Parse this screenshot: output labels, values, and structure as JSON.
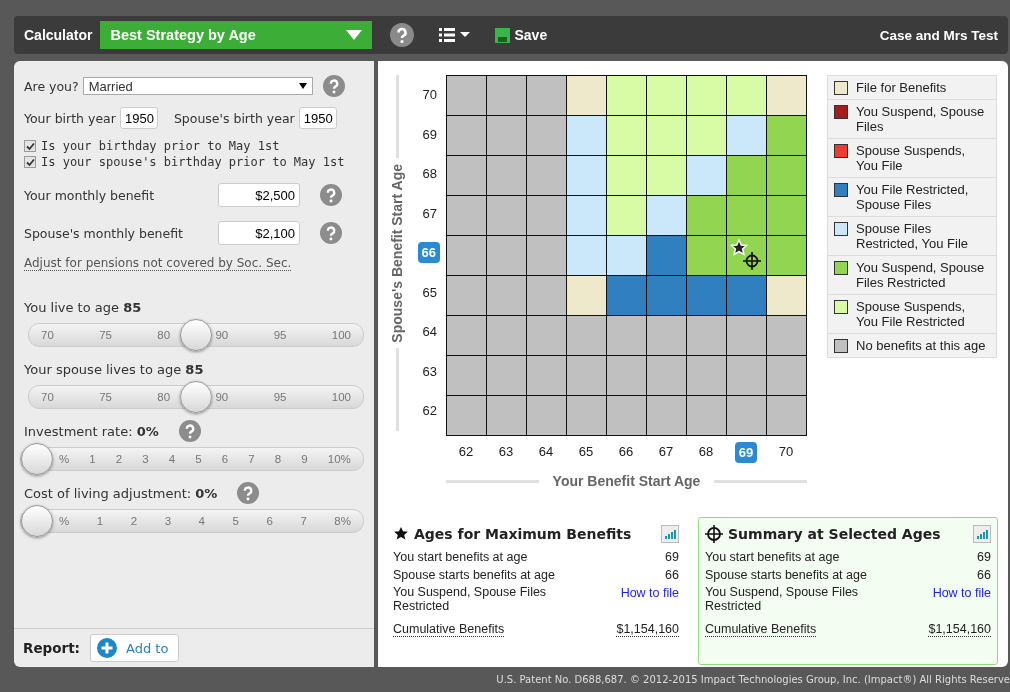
{
  "top_bar": {
    "title": "Calculator",
    "view_select": "Best Strategy by Age",
    "save": "Save",
    "user": "Case and Mrs Test"
  },
  "form": {
    "marital": {
      "label": "Are you?",
      "value": "Married",
      "help": true
    },
    "birth_years": [
      {
        "label": "Your birth year",
        "value": "1950"
      },
      {
        "label": "Spouse's birth year",
        "value": "1950"
      }
    ],
    "checkboxes": [
      {
        "label": "Is your birthday prior to May 1st",
        "checked": true
      },
      {
        "label": "Is your spouse's birthday prior to May 1st",
        "checked": true
      }
    ],
    "benefits": [
      {
        "label": "Your monthly benefit",
        "value": "$2,500",
        "help": true
      },
      {
        "label": "Spouse's monthly benefit",
        "value": "$2,100",
        "help": true
      }
    ],
    "pension_link": "Adjust for pensions not covered by Soc. Sec.",
    "sliders": [
      {
        "label": "You live to age **85**",
        "help": false,
        "level": 0.5,
        "ticks": [
          "70",
          "75",
          "80",
          "90",
          "95",
          "100"
        ]
      },
      {
        "label": "Your spouse lives to age **85**",
        "help": false,
        "level": 0.5,
        "ticks": [
          "70",
          "75",
          "80",
          "90",
          "95",
          "100"
        ]
      },
      {
        "label": "Investment rate: **0%**",
        "help": true,
        "level": 0,
        "ticks": [
          "%",
          "1",
          "2",
          "3",
          "4",
          "5",
          "6",
          "7",
          "8",
          "9",
          "10%"
        ]
      },
      {
        "label": "Cost of living adjustment: **0%**",
        "help": true,
        "level": 0,
        "ticks": [
          "%",
          "1",
          "2",
          "3",
          "4",
          "5",
          "6",
          "7",
          "8%"
        ]
      }
    ]
  },
  "report": {
    "label": "Report:",
    "button": "Add to"
  },
  "grid": {
    "y_title": "Spouse's Benefit Start Age",
    "x_title": "Your Benefit Start Age",
    "rows": [
      {
        "label": "70",
        "selected": false,
        "max": false,
        "cells": [
          {
            "color": "#c0c0c0"
          },
          {
            "color": "#c0c0c0"
          },
          {
            "color": "#c0c0c0"
          },
          {
            "color": "#efe9cb"
          },
          {
            "color": "#d8fba6"
          },
          {
            "color": "#d8fba6"
          },
          {
            "color": "#d8fba6"
          },
          {
            "color": "#d8fba6"
          },
          {
            "color": "#efe9cb"
          }
        ]
      },
      {
        "label": "69",
        "selected": false,
        "max": false,
        "cells": [
          {
            "color": "#c0c0c0"
          },
          {
            "color": "#c0c0c0"
          },
          {
            "color": "#c0c0c0"
          },
          {
            "color": "#cbe8fb"
          },
          {
            "color": "#d8fba6"
          },
          {
            "color": "#d8fba6"
          },
          {
            "color": "#d8fba6"
          },
          {
            "color": "#cbe8fb"
          },
          {
            "color": "#92d550"
          }
        ]
      },
      {
        "label": "68",
        "selected": false,
        "max": false,
        "cells": [
          {
            "color": "#c0c0c0"
          },
          {
            "color": "#c0c0c0"
          },
          {
            "color": "#c0c0c0"
          },
          {
            "color": "#cbe8fb"
          },
          {
            "color": "#d8fba6"
          },
          {
            "color": "#d8fba6"
          },
          {
            "color": "#cbe8fb"
          },
          {
            "color": "#92d550"
          },
          {
            "color": "#92d550"
          }
        ]
      },
      {
        "label": "67",
        "selected": false,
        "max": false,
        "cells": [
          {
            "color": "#c0c0c0"
          },
          {
            "color": "#c0c0c0"
          },
          {
            "color": "#c0c0c0"
          },
          {
            "color": "#cbe8fb"
          },
          {
            "color": "#d8fba6"
          },
          {
            "color": "#cbe8fb"
          },
          {
            "color": "#92d550"
          },
          {
            "color": "#92d550"
          },
          {
            "color": "#92d550"
          }
        ]
      },
      {
        "label": "66",
        "selected": true,
        "max": true,
        "cells": [
          {
            "color": "#c0c0c0"
          },
          {
            "color": "#c0c0c0"
          },
          {
            "color": "#c0c0c0"
          },
          {
            "color": "#cbe8fb"
          },
          {
            "color": "#cbe8fb"
          },
          {
            "color": "#3080c0"
          },
          {
            "color": "#92d550"
          },
          {
            "color": "#92d550"
          },
          {
            "color": "#92d550"
          }
        ]
      },
      {
        "label": "65",
        "selected": false,
        "max": false,
        "cells": [
          {
            "color": "#c0c0c0"
          },
          {
            "color": "#c0c0c0"
          },
          {
            "color": "#c0c0c0"
          },
          {
            "color": "#efe9cb"
          },
          {
            "color": "#3080c0"
          },
          {
            "color": "#3080c0"
          },
          {
            "color": "#3080c0"
          },
          {
            "color": "#3080c0"
          },
          {
            "color": "#efe9cb"
          }
        ]
      },
      {
        "label": "64",
        "selected": false,
        "max": false,
        "cells": [
          {
            "color": "#c0c0c0"
          },
          {
            "color": "#c0c0c0"
          },
          {
            "color": "#c0c0c0"
          },
          {
            "color": "#c0c0c0"
          },
          {
            "color": "#c0c0c0"
          },
          {
            "color": "#c0c0c0"
          },
          {
            "color": "#c0c0c0"
          },
          {
            "color": "#c0c0c0"
          },
          {
            "color": "#c0c0c0"
          }
        ]
      },
      {
        "label": "63",
        "selected": false,
        "max": false,
        "cells": [
          {
            "color": "#c0c0c0"
          },
          {
            "color": "#c0c0c0"
          },
          {
            "color": "#c0c0c0"
          },
          {
            "color": "#c0c0c0"
          },
          {
            "color": "#c0c0c0"
          },
          {
            "color": "#c0c0c0"
          },
          {
            "color": "#c0c0c0"
          },
          {
            "color": "#c0c0c0"
          },
          {
            "color": "#c0c0c0"
          }
        ]
      },
      {
        "label": "62",
        "selected": false,
        "max": false,
        "cells": [
          {
            "color": "#c0c0c0"
          },
          {
            "color": "#c0c0c0"
          },
          {
            "color": "#c0c0c0"
          },
          {
            "color": "#c0c0c0"
          },
          {
            "color": "#c0c0c0"
          },
          {
            "color": "#c0c0c0"
          },
          {
            "color": "#c0c0c0"
          },
          {
            "color": "#c0c0c0"
          },
          {
            "color": "#c0c0c0"
          }
        ]
      }
    ],
    "columns": [
      {
        "label": "62",
        "selected": false,
        "max": false
      },
      {
        "label": "63",
        "selected": false,
        "max": false
      },
      {
        "label": "64",
        "selected": false,
        "max": false
      },
      {
        "label": "65",
        "selected": false,
        "max": false
      },
      {
        "label": "66",
        "selected": false,
        "max": false
      },
      {
        "label": "67",
        "selected": false,
        "max": false
      },
      {
        "label": "68",
        "selected": false,
        "max": false
      },
      {
        "label": "69",
        "selected": true,
        "max": true
      },
      {
        "label": "70",
        "selected": false,
        "max": false
      }
    ]
  },
  "legend": [
    {
      "label": "File for Benefits",
      "color": "#efe9cb"
    },
    {
      "label": "You Suspend, Spouse Files",
      "color": "#a41d1d"
    },
    {
      "label": "Spouse Suspends, You File",
      "color": "#f03a32"
    },
    {
      "label": "You File Restricted, Spouse Files",
      "color": "#3080c0"
    },
    {
      "label": "Spouse Files Restricted, You File",
      "color": "#cbe8fb"
    },
    {
      "label": "You Suspend, Spouse Files Restricted",
      "color": "#92d550"
    },
    {
      "label": "Spouse Suspends, You File Restricted",
      "color": "#d8fba6"
    },
    {
      "label": "No benefits at this age",
      "color": "#c0c0c0"
    }
  ],
  "summaries": [
    {
      "kind": "star",
      "title": "Ages for Maximum Benefits",
      "highlighted": false,
      "rows": [
        {
          "kind": "value",
          "label": "You start benefits at age",
          "value": "69"
        },
        {
          "kind": "value",
          "label": "Spouse starts benefits at age",
          "value": "66"
        },
        {
          "kind": "link",
          "label": "You Suspend, Spouse Files Restricted",
          "value": "How to file"
        },
        {
          "kind": "total",
          "label": "Cumulative Benefits",
          "value": "$1,154,160"
        }
      ]
    },
    {
      "kind": "crosshair",
      "title": "Summary at Selected Ages",
      "highlighted": true,
      "rows": [
        {
          "kind": "value",
          "label": "You start benefits at age",
          "value": "69"
        },
        {
          "kind": "value",
          "label": "Spouse starts benefits at age",
          "value": "66"
        },
        {
          "kind": "link",
          "label": "You Suspend, Spouse Files Restricted",
          "value": "How to file"
        },
        {
          "kind": "total",
          "label": "Cumulative Benefits",
          "value": "$1,154,160"
        }
      ]
    }
  ],
  "footer": "U.S. Patent No. D688,687. © 2012-2015 Impact Technologies Group, Inc. (Impact®) All Rights Reserve"
}
